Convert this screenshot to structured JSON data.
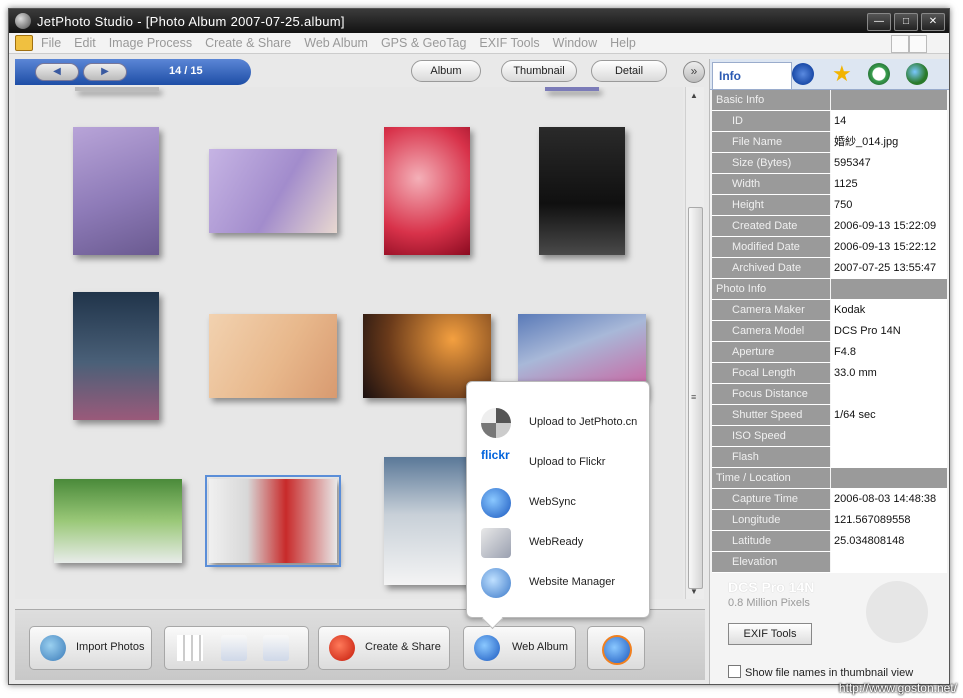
{
  "window": {
    "title": "JetPhoto Studio - [Photo Album 2007-07-25.album]"
  },
  "menu": [
    "File",
    "Edit",
    "Image Process",
    "Create & Share",
    "Web Album",
    "GPS & GeoTag",
    "EXIF Tools",
    "Window",
    "Help"
  ],
  "nav": {
    "page": "14 / 15",
    "views": [
      "Album",
      "Thumbnail",
      "Detail"
    ]
  },
  "popup": {
    "items": [
      {
        "label": "Upload to JetPhoto.cn",
        "icon": "jetphoto-upload-icon"
      },
      {
        "label": "Upload to Flickr",
        "icon": "flickr-upload-icon"
      },
      {
        "label": "WebSync",
        "icon": "websync-icon"
      },
      {
        "label": "WebReady",
        "icon": "webready-icon"
      },
      {
        "label": "Website Manager",
        "icon": "website-manager-icon"
      }
    ],
    "flickr_logo": "flickr"
  },
  "toolbar": {
    "import": "Import Photos",
    "create": "Create & Share",
    "web": "Web Album"
  },
  "info": {
    "tab_label": "Info",
    "sections": [
      {
        "title": "Basic Info",
        "rows": [
          {
            "k": "ID",
            "v": "14"
          },
          {
            "k": "File Name",
            "v": "婚紗_014.jpg"
          },
          {
            "k": "Size (Bytes)",
            "v": "595347"
          },
          {
            "k": "Width",
            "v": "1125"
          },
          {
            "k": "Height",
            "v": "750"
          },
          {
            "k": "Created Date",
            "v": "2006-09-13 15:22:09"
          },
          {
            "k": "Modified Date",
            "v": "2006-09-13 15:22:12"
          },
          {
            "k": "Archived Date",
            "v": "2007-07-25 13:55:47"
          }
        ]
      },
      {
        "title": "Photo Info",
        "rows": [
          {
            "k": "Camera Maker",
            "v": "Kodak"
          },
          {
            "k": "Camera Model",
            "v": "DCS Pro 14N"
          },
          {
            "k": "Aperture",
            "v": "F4.8"
          },
          {
            "k": "Focal Length",
            "v": "33.0 mm"
          },
          {
            "k": "Focus Distance",
            "v": ""
          },
          {
            "k": "Shutter Speed",
            "v": "1/64 sec"
          },
          {
            "k": "ISO Speed",
            "v": ""
          },
          {
            "k": "Flash",
            "v": ""
          }
        ]
      },
      {
        "title": "Time / Location",
        "rows": [
          {
            "k": "Capture Time",
            "v": "2006-08-03 14:48:38"
          },
          {
            "k": "Longitude",
            "v": "121.567089558"
          },
          {
            "k": "Latitude",
            "v": "25.034808148"
          },
          {
            "k": "Elevation",
            "v": ""
          }
        ]
      }
    ],
    "camera_model": "DCS Pro 14N",
    "camera_pixels": "0.8 Million Pixels",
    "exif_button": "EXIF Tools",
    "show_filenames": "Show file names in thumbnail view"
  },
  "watermark": "http://www.goston.net/",
  "colors": {
    "nav_blue": "#1e4ea6",
    "info_tab_text": "#2a59b2",
    "selection": "#5b8ed8"
  }
}
